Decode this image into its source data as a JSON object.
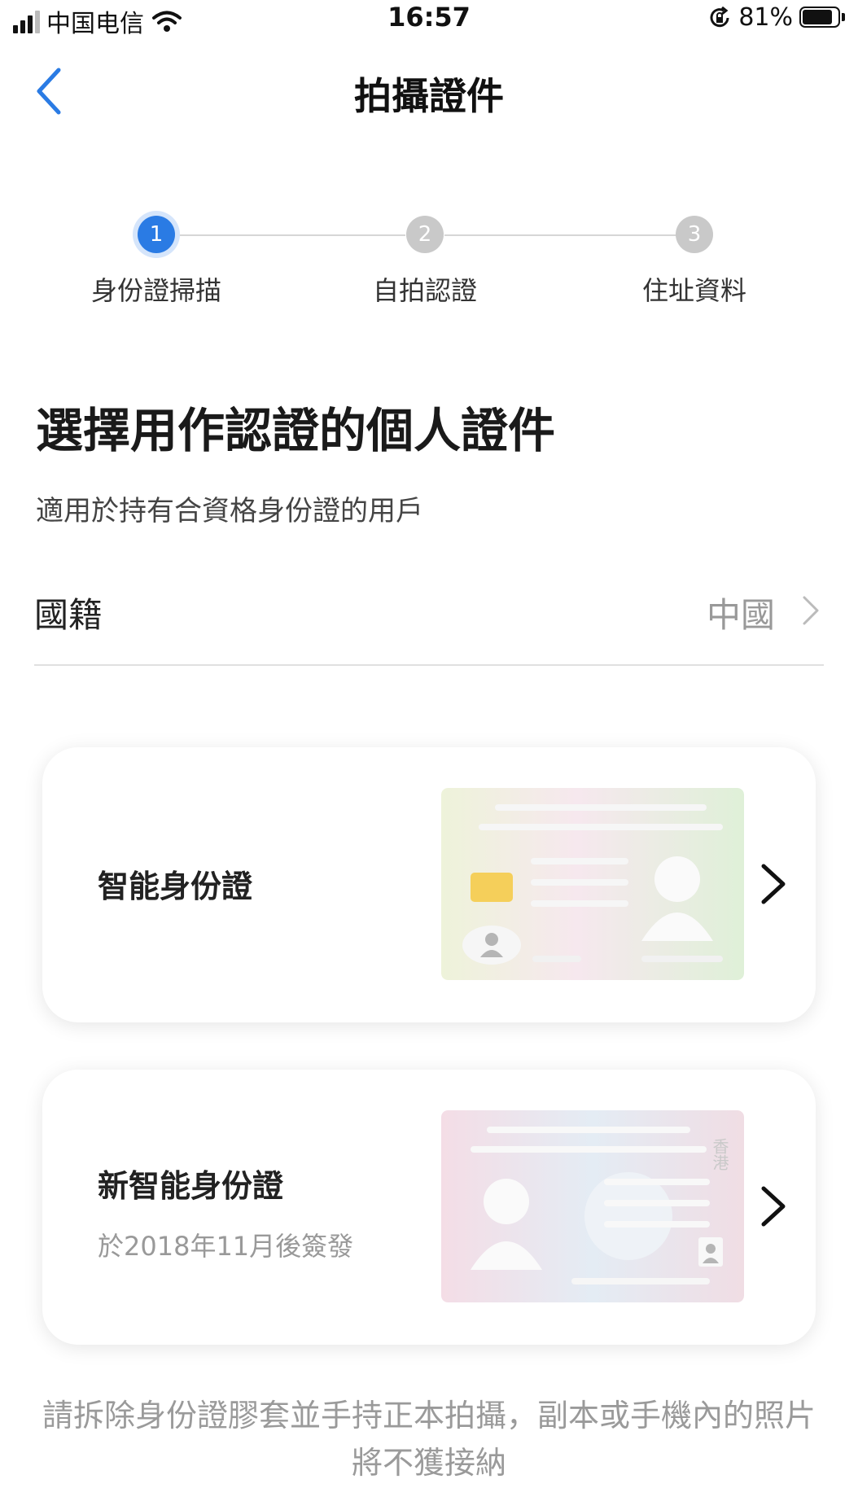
{
  "status_bar": {
    "carrier": "中国电信",
    "time": "16:57",
    "battery_percent": "81%"
  },
  "nav": {
    "title": "拍攝證件"
  },
  "steps": [
    {
      "number": "1",
      "label": "身份證掃描",
      "active": true
    },
    {
      "number": "2",
      "label": "自拍認證",
      "active": false
    },
    {
      "number": "3",
      "label": "住址資料",
      "active": false
    }
  ],
  "main": {
    "heading": "選擇用作認證的個人證件",
    "subtext": "適用於持有合資格身份證的用戶"
  },
  "nationality": {
    "label": "國籍",
    "value": "中國"
  },
  "cards": [
    {
      "title": "智能身份證",
      "subtitle": ""
    },
    {
      "title": "新智能身份證",
      "subtitle": "於2018年11月後簽發"
    }
  ],
  "card_art": {
    "card2_vertical_text": "香港"
  },
  "footnote": "請拆除身份證膠套並手持正本拍攝，副本或手機內的照片將不獲接納",
  "colors": {
    "accent": "#2a7be4",
    "inactive_step": "#c9c9c9",
    "chip_yellow": "#f5cf5a"
  }
}
